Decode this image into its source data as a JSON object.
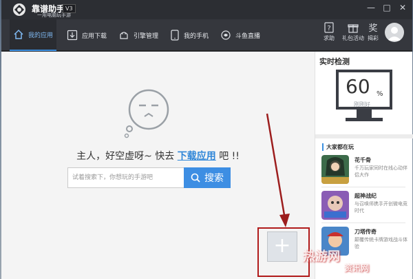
{
  "window": {
    "brand": "靠谱助手",
    "brand_sub": "一用电脑玩手游",
    "version": "V3",
    "minimize": "—",
    "maximize": "□",
    "close": "✕"
  },
  "nav": {
    "items": [
      {
        "label": "我的应用",
        "active": true
      },
      {
        "label": "应用下载",
        "active": false
      },
      {
        "label": "引擎管理",
        "active": false
      },
      {
        "label": "我的手机",
        "active": false
      },
      {
        "label": "斗鱼直播",
        "active": false
      }
    ],
    "top_icons": [
      {
        "label": "求助",
        "icon": "help-icon"
      },
      {
        "label": "礼包活动",
        "icon": "gift-icon"
      },
      {
        "label": "揭彩",
        "icon": "lottery-icon"
      }
    ]
  },
  "main": {
    "empty_prefix": "主人，好空虚呀~ 快去 ",
    "empty_link": "下载应用",
    "empty_suffix": " 吧 !!",
    "search_placeholder": "试着搜索下，你想玩的手游吧",
    "search_button": "搜索"
  },
  "sidebar": {
    "title": "实时检测",
    "score": "60",
    "score_unit": "%",
    "score_status": "刚刚好",
    "players_title": "大家都在玩",
    "games": [
      {
        "name": "花千骨",
        "desc": "千万玩家同时在线心动伴侣大作"
      },
      {
        "name": "超神战纪",
        "desc": "与召唤师携手开创微电竞时代"
      },
      {
        "name": "刀塔传奇",
        "desc": "颠覆传统卡牌游戏战斗体验"
      }
    ]
  },
  "overlay": {
    "add_symbol": "+",
    "watermark": "热游网",
    "watermark2": "资讯网"
  },
  "colors": {
    "accent": "#3b8fe0",
    "annotation": "#b01a1a"
  }
}
